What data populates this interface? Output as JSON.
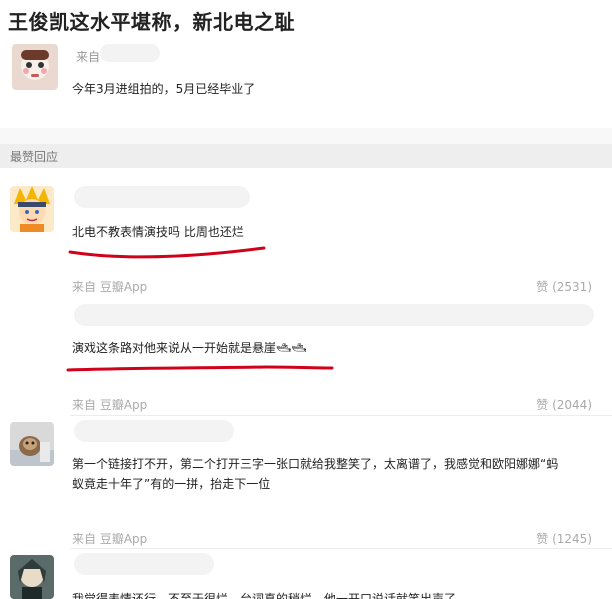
{
  "page": {
    "title": "王俊凯这水平堪称，新北电之耻"
  },
  "post": {
    "from_label": "来自",
    "content": "今年3月进组拍的，5月已经毕业了"
  },
  "section": {
    "label": "最赞回应"
  },
  "comments": [
    {
      "text": "北电不教表情演技吗 比周也还烂",
      "source": "来自 豆瓣App",
      "likes": "赞 (2531)"
    },
    {
      "text": "演戏这条路对他来说从一开始就是悬崖🛥🛥",
      "source": "来自 豆瓣App",
      "likes": "赞 (2044)"
    },
    {
      "text_line1": "第一个链接打不开，第二个打开三字一张口就给我整笑了，太离谱了，我感觉和欧阳娜娜“蚂",
      "text_line2": "蚁竟走十年了”有的一拼，抬走下一位",
      "source": "来自 豆瓣App",
      "likes": "赞 (1245)"
    },
    {
      "text_partial": "我觉得表情还行，不至于很烂，台词真的稍烂，他一开口说话就笑出声了"
    }
  ],
  "colors": {
    "underline": "#d0021b",
    "section_bg": "#eeeeee",
    "muted": "#aaaaaa"
  }
}
